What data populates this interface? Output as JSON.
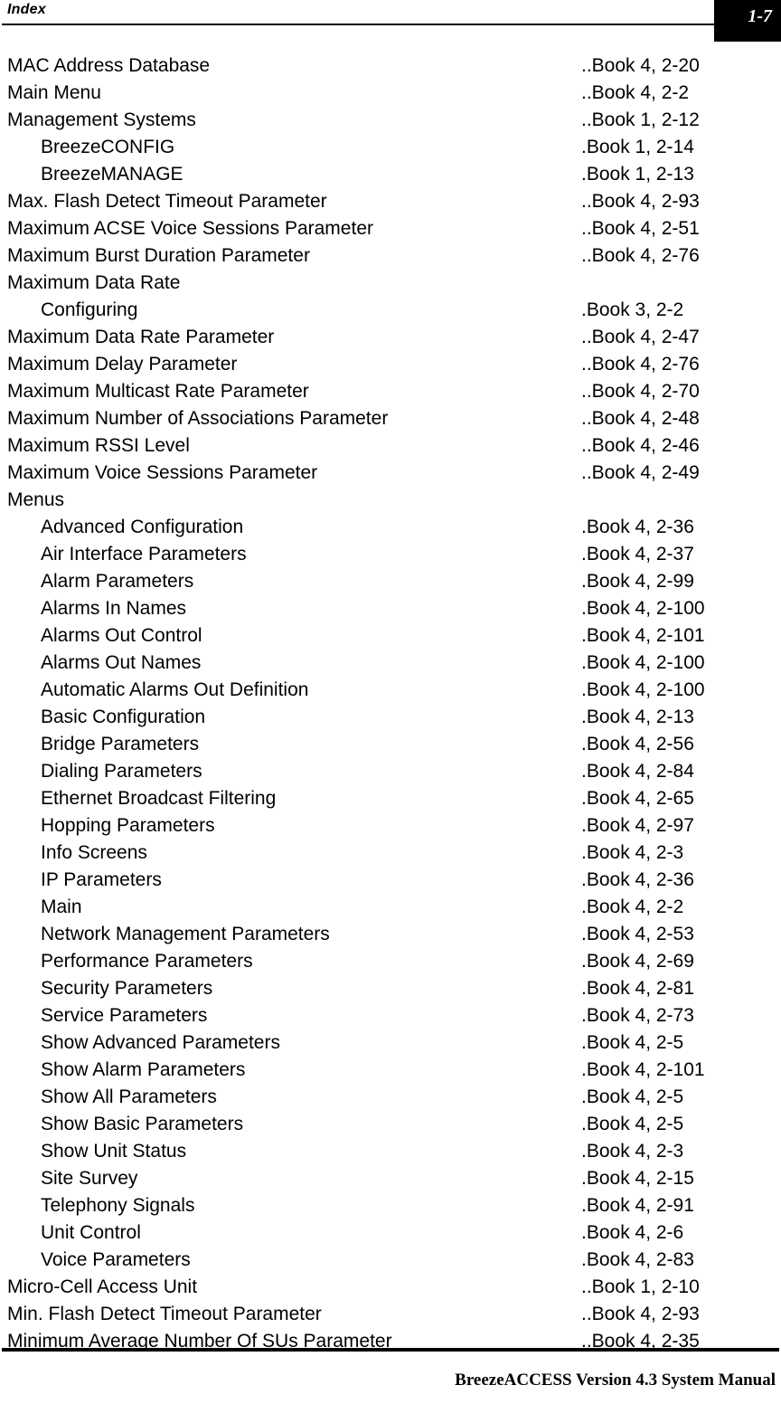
{
  "header": {
    "section_title": "Index",
    "page_number": "1-7"
  },
  "footer": {
    "manual_title": "BreezeACCESS Version 4.3 System Manual"
  },
  "index_entries": [
    {
      "term": "MAC Address Database",
      "ref": "..Book 4, 2-20",
      "level": 0
    },
    {
      "term": "Main Menu",
      "ref": "..Book 4, 2-2",
      "level": 0
    },
    {
      "term": "Management Systems",
      "ref": "..Book 1, 2-12",
      "level": 0
    },
    {
      "term": "BreezeCONFIG",
      "ref": ".Book 1, 2-14",
      "level": 1
    },
    {
      "term": "BreezeMANAGE",
      "ref": ".Book 1, 2-13",
      "level": 1
    },
    {
      "term": "Max. Flash Detect Timeout Parameter",
      "ref": "..Book 4, 2-93",
      "level": 0
    },
    {
      "term": "Maximum ACSE Voice Sessions Parameter",
      "ref": "..Book 4, 2-51",
      "level": 0
    },
    {
      "term": "Maximum Burst Duration Parameter",
      "ref": "..Book 4, 2-76",
      "level": 0
    },
    {
      "term": "Maximum Data Rate",
      "ref": "",
      "level": 0
    },
    {
      "term": "Configuring",
      "ref": ".Book 3, 2-2",
      "level": 1
    },
    {
      "term": "Maximum Data Rate Parameter",
      "ref": "..Book 4, 2-47",
      "level": 0
    },
    {
      "term": "Maximum Delay Parameter",
      "ref": "..Book 4, 2-76",
      "level": 0
    },
    {
      "term": "Maximum Multicast Rate Parameter",
      "ref": "..Book 4, 2-70",
      "level": 0
    },
    {
      "term": "Maximum Number of Associations Parameter",
      "ref": "..Book 4, 2-48",
      "level": 0
    },
    {
      "term": "Maximum RSSI Level",
      "ref": "..Book 4, 2-46",
      "level": 0
    },
    {
      "term": "Maximum Voice Sessions Parameter",
      "ref": "..Book 4, 2-49",
      "level": 0
    },
    {
      "term": "Menus",
      "ref": "",
      "level": 0
    },
    {
      "term": "Advanced Configuration",
      "ref": ".Book 4, 2-36",
      "level": 1
    },
    {
      "term": "Air Interface Parameters",
      "ref": ".Book 4, 2-37",
      "level": 1
    },
    {
      "term": "Alarm Parameters",
      "ref": ".Book 4, 2-99",
      "level": 1
    },
    {
      "term": "Alarms In Names",
      "ref": ".Book 4, 2-100",
      "level": 1
    },
    {
      "term": "Alarms Out Control",
      "ref": ".Book 4, 2-101",
      "level": 1
    },
    {
      "term": "Alarms Out Names",
      "ref": ".Book 4, 2-100",
      "level": 1
    },
    {
      "term": "Automatic Alarms Out Definition",
      "ref": ".Book 4, 2-100",
      "level": 1
    },
    {
      "term": "Basic Configuration",
      "ref": ".Book 4, 2-13",
      "level": 1
    },
    {
      "term": "Bridge Parameters",
      "ref": ".Book 4, 2-56",
      "level": 1
    },
    {
      "term": "Dialing Parameters",
      "ref": ".Book 4, 2-84",
      "level": 1
    },
    {
      "term": "Ethernet Broadcast Filtering",
      "ref": ".Book 4, 2-65",
      "level": 1
    },
    {
      "term": "Hopping Parameters",
      "ref": ".Book 4, 2-97",
      "level": 1
    },
    {
      "term": "Info Screens",
      "ref": ".Book 4, 2-3",
      "level": 1
    },
    {
      "term": "IP Parameters",
      "ref": ".Book 4, 2-36",
      "level": 1
    },
    {
      "term": "Main",
      "ref": ".Book 4, 2-2",
      "level": 1
    },
    {
      "term": "Network Management Parameters",
      "ref": ".Book 4, 2-53",
      "level": 1
    },
    {
      "term": "Performance Parameters",
      "ref": ".Book 4, 2-69",
      "level": 1
    },
    {
      "term": "Security Parameters",
      "ref": ".Book 4, 2-81",
      "level": 1
    },
    {
      "term": "Service Parameters",
      "ref": ".Book 4, 2-73",
      "level": 1
    },
    {
      "term": "Show Advanced Parameters",
      "ref": ".Book 4, 2-5",
      "level": 1
    },
    {
      "term": "Show Alarm Parameters",
      "ref": ".Book 4, 2-101",
      "level": 1
    },
    {
      "term": "Show All Parameters",
      "ref": ".Book 4, 2-5",
      "level": 1
    },
    {
      "term": "Show Basic Parameters",
      "ref": ".Book 4, 2-5",
      "level": 1
    },
    {
      "term": "Show Unit Status",
      "ref": ".Book 4, 2-3",
      "level": 1
    },
    {
      "term": "Site Survey",
      "ref": ".Book 4, 2-15",
      "level": 1
    },
    {
      "term": "Telephony Signals",
      "ref": ".Book 4, 2-91",
      "level": 1
    },
    {
      "term": "Unit Control",
      "ref": ".Book 4, 2-6",
      "level": 1
    },
    {
      "term": "Voice Parameters",
      "ref": ".Book 4, 2-83",
      "level": 1
    },
    {
      "term": "Micro-Cell Access Unit",
      "ref": "..Book 1, 2-10",
      "level": 0
    },
    {
      "term": "Min. Flash Detect Timeout Parameter",
      "ref": "..Book 4, 2-93",
      "level": 0
    },
    {
      "term": "Minimum Average Number Of SUs Parameter",
      "ref": "..Book 4, 2-35",
      "level": 0
    }
  ]
}
